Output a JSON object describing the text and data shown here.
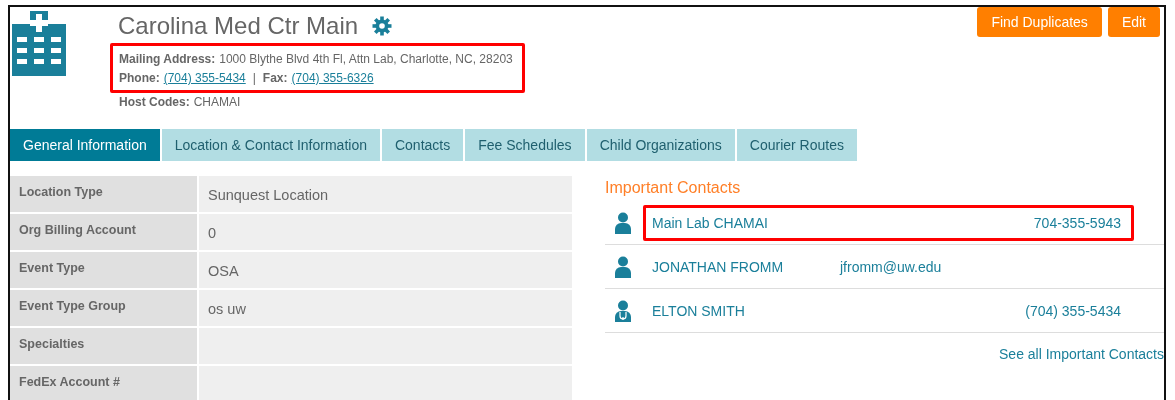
{
  "header": {
    "title": "Carolina Med Ctr Main",
    "highlighted": true,
    "mailing_address": {
      "label": "Mailing Address:",
      "value": "1000 Blythe Blvd 4th Fl, Attn Lab, Charlotte, NC, 28203"
    },
    "phone": {
      "label": "Phone:",
      "value": "(704) 355-5434"
    },
    "separator": "|",
    "fax": {
      "label": "Fax:",
      "value": "(704) 355-6326"
    },
    "host_codes": {
      "label": "Host Codes:",
      "value": "CHAMAI"
    }
  },
  "buttons": [
    "Find Duplicates",
    "Edit"
  ],
  "tabs": [
    {
      "label": "General Information",
      "selected": true
    },
    {
      "label": "Location & Contact Information",
      "selected": false
    },
    {
      "label": "Contacts",
      "selected": false
    },
    {
      "label": "Fee Schedules",
      "selected": false
    },
    {
      "label": "Child Organizations",
      "selected": false
    },
    {
      "label": "Courier Routes",
      "selected": false
    }
  ],
  "details": [
    {
      "label": "Location Type",
      "value": "Sunquest Location"
    },
    {
      "label": "Org Billing Account",
      "value": "0"
    },
    {
      "label": "Event Type",
      "value": "OSA"
    },
    {
      "label": "Event Type Group",
      "value": "os uw"
    },
    {
      "label": "Specialties"
    },
    {
      "label": "FedEx Account #"
    }
  ],
  "important_contacts": {
    "title": "Important Contacts",
    "link": "See all Important Contacts",
    "rows": [
      {
        "kind": "person",
        "name": "Main Lab CHAMAI",
        "phone": "704-355-5943",
        "highlighted": true
      },
      {
        "kind": "person",
        "name": "JONATHAN FROMM",
        "email": "jfromm@uw.edu",
        "highlighted": false
      },
      {
        "kind": "doctor",
        "name": "ELTON SMITH",
        "phone": "(704) 355-5434",
        "highlighted": false
      }
    ]
  }
}
